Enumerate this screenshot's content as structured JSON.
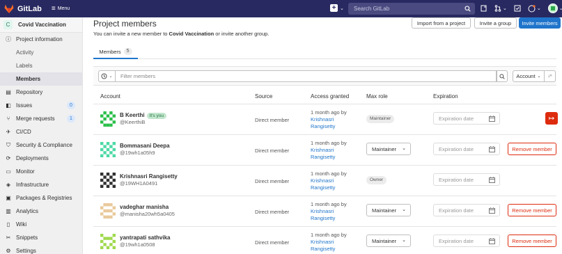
{
  "topbar": {
    "brand": "GitLab",
    "menu_label": "Menu",
    "search_placeholder": "Search GitLab",
    "plus_caret": "⌄",
    "mr_caret": "⌄",
    "help_caret": "⌄"
  },
  "sidebar": {
    "project_initial": "C",
    "project_name": "Covid Vaccination",
    "items": [
      {
        "label": "Project information",
        "icon": "info-icon",
        "head": true
      },
      {
        "label": "Activity",
        "sub": true
      },
      {
        "label": "Labels",
        "sub": true
      },
      {
        "label": "Members",
        "sub": true,
        "active": true
      },
      {
        "label": "Repository",
        "icon": "document-icon"
      },
      {
        "label": "Issues",
        "icon": "issues-icon",
        "count": "0"
      },
      {
        "label": "Merge requests",
        "icon": "merge-request-icon",
        "count": "1"
      },
      {
        "label": "CI/CD",
        "icon": "rocket-icon"
      },
      {
        "label": "Security & Compliance",
        "icon": "shield-icon"
      },
      {
        "label": "Deployments",
        "icon": "deployments-icon"
      },
      {
        "label": "Monitor",
        "icon": "monitor-icon"
      },
      {
        "label": "Infrastructure",
        "icon": "infrastructure-icon"
      },
      {
        "label": "Packages & Registries",
        "icon": "package-icon"
      },
      {
        "label": "Analytics",
        "icon": "chart-icon"
      },
      {
        "label": "Wiki",
        "icon": "book-icon"
      },
      {
        "label": "Snippets",
        "icon": "scissors-icon"
      },
      {
        "label": "Settings",
        "icon": "gear-icon"
      }
    ]
  },
  "main": {
    "title": "Project members",
    "import_label": "Import from a project",
    "invite_group_label": "Invite a group",
    "invite_members_label": "Invite members",
    "invite_prefix": "You can invite a new member to ",
    "invite_project": "Covid Vaccination",
    "invite_suffix": " or invite another group.",
    "tab_label": "Members",
    "tab_count": "5",
    "filter_placeholder": "Filter members",
    "sort_label": "Account",
    "columns": [
      "Account",
      "Source",
      "Access granted",
      "Max role",
      "Expiration"
    ],
    "expiration_placeholder": "Expiration date",
    "remove_label": "Remove member",
    "its_you_label": "It's you",
    "members": [
      {
        "name": "B Keerthi",
        "username": "@KeerthiB",
        "source": "Direct member",
        "granted": "1 month ago by",
        "granter_first": "Krishnasri",
        "granter_last": "Rangisetty",
        "role": "Maintainer",
        "role_type": "badge",
        "self": true,
        "avatar_color": "#2bbf4a"
      },
      {
        "name": "Bommasani Deepa",
        "username": "@19wh1a05h9",
        "source": "Direct member",
        "granted": "1 month ago by",
        "granter_first": "Krishnasri",
        "granter_last": "Rangisetty",
        "role": "Maintainer",
        "role_type": "select",
        "avatar_color": "#4dd9a6"
      },
      {
        "name": "Krishnasri Rangisetty",
        "username": "@19WH1A0491",
        "source": "Direct member",
        "granted": "1 month ago by",
        "granter_first": "Krishnasri",
        "granter_last": "Rangisetty",
        "role": "Owner",
        "role_type": "badge",
        "avatar_color": "#303030"
      },
      {
        "name": "vadeghar manisha",
        "username": "@manisha20wh5a0405",
        "source": "Direct member",
        "granted": "1 month ago by",
        "granter_first": "Krishnasri",
        "granter_last": "Rangisetty",
        "role": "Maintainer",
        "role_type": "select",
        "avatar_color": "#e9c99a"
      },
      {
        "name": "yantrapati sathvika",
        "username": "@19wh1a0508",
        "source": "Direct member",
        "granted": "1 month ago by",
        "granter_first": "Krishnasri",
        "granter_last": "Rangisetty",
        "role": "Maintainer",
        "role_type": "select",
        "avatar_color": "#9fd94d"
      }
    ]
  }
}
